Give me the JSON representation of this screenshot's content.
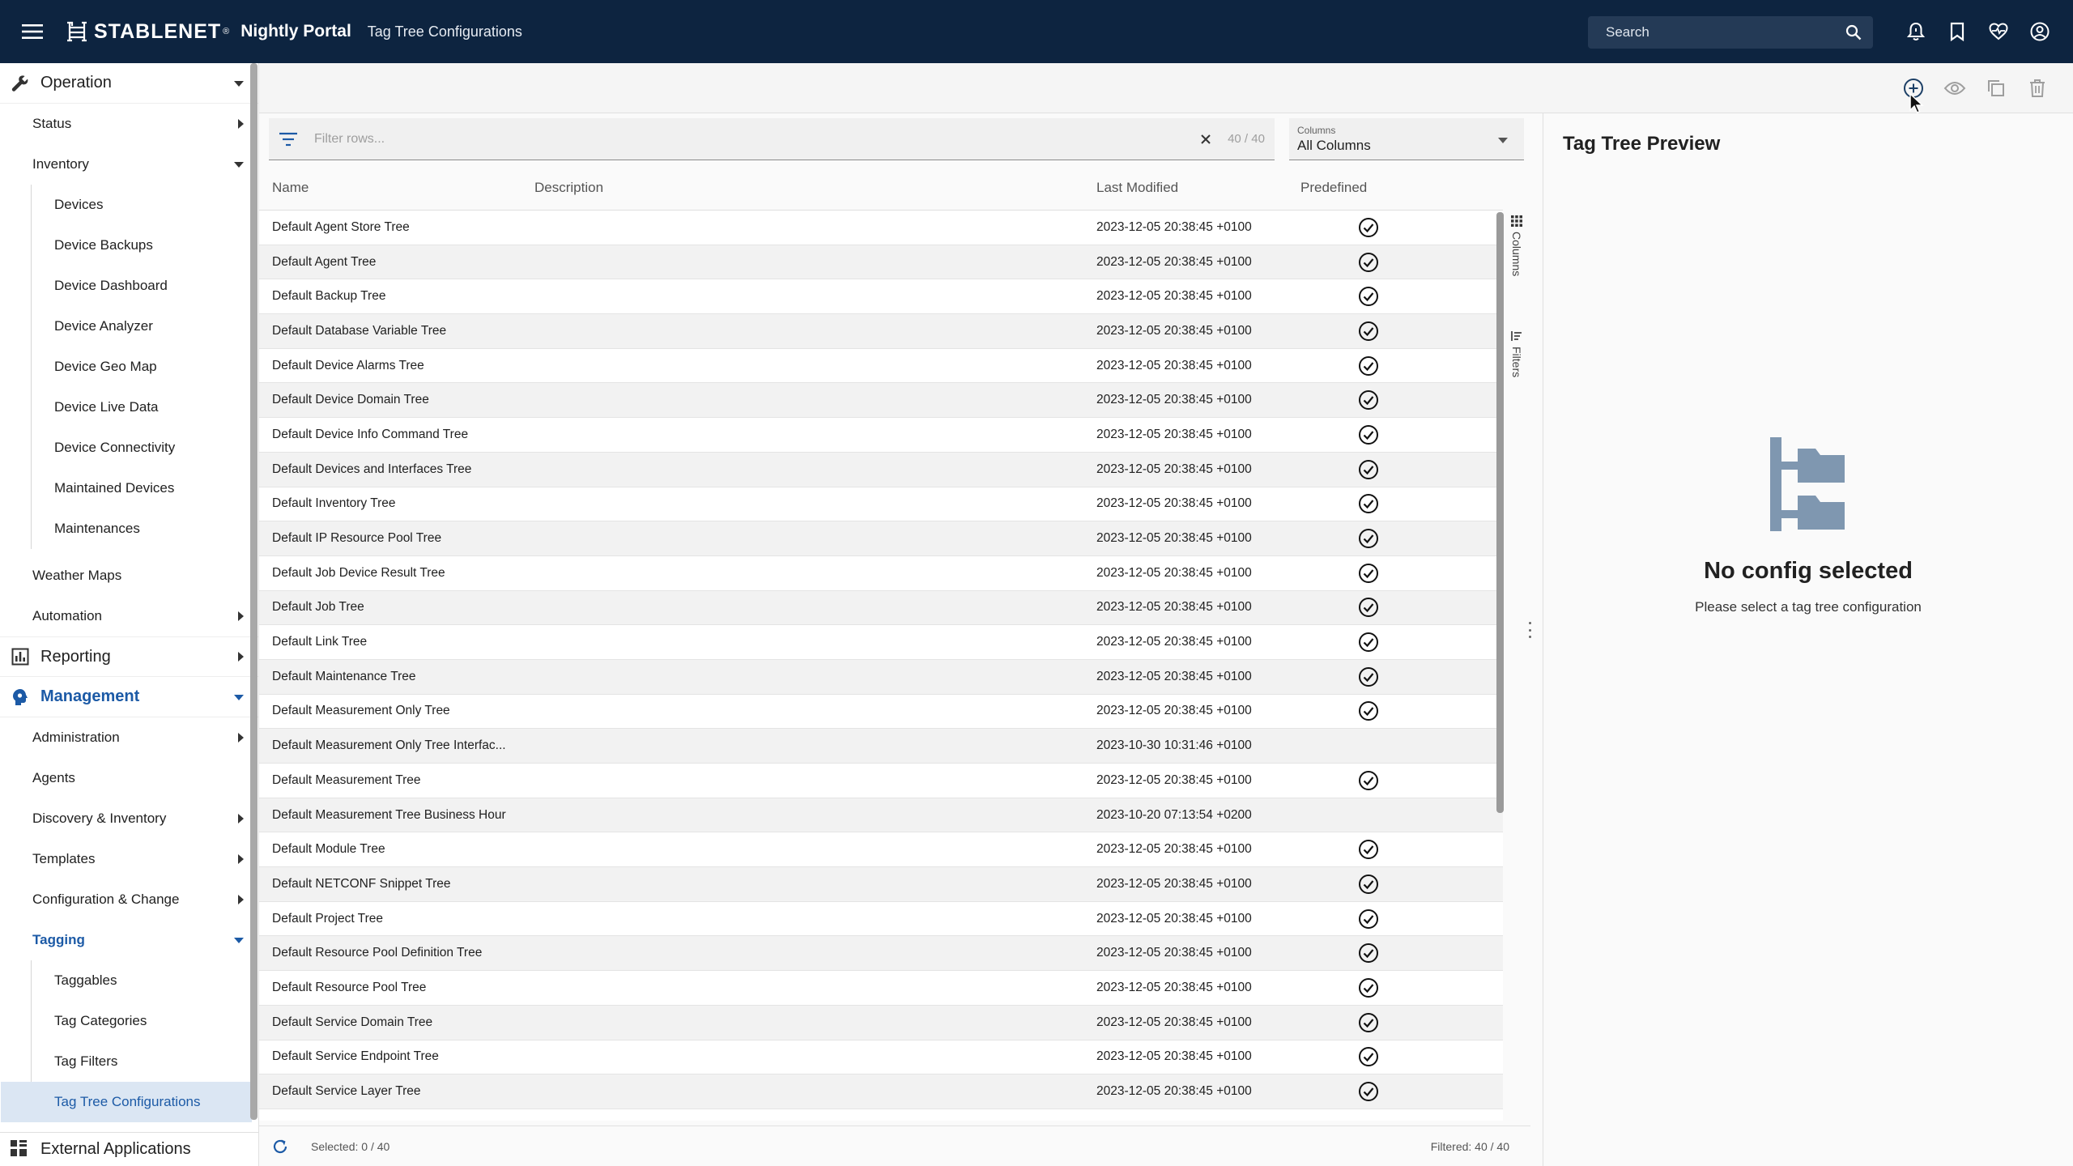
{
  "header": {
    "brand": "STABLENET",
    "brand_sup": "®",
    "portal": "Nightly Portal",
    "page": "Tag Tree Configurations",
    "search_placeholder": "Search"
  },
  "sidebar": {
    "operation": "Operation",
    "status": "Status",
    "inventory": "Inventory",
    "inventory_items": [
      "Devices",
      "Device Backups",
      "Device Dashboard",
      "Device Analyzer",
      "Device Geo Map",
      "Device Live Data",
      "Device Connectivity",
      "Maintained Devices",
      "Maintenances"
    ],
    "weather_maps": "Weather Maps",
    "automation": "Automation",
    "reporting": "Reporting",
    "management": "Management",
    "administration": "Administration",
    "agents": "Agents",
    "discovery": "Discovery & Inventory",
    "templates": "Templates",
    "config_change": "Configuration & Change",
    "tagging": "Tagging",
    "tagging_items": [
      "Taggables",
      "Tag Categories",
      "Tag Filters",
      "Tag Tree Configurations"
    ],
    "external": "External Applications"
  },
  "filter": {
    "placeholder": "Filter rows...",
    "count": "40 / 40",
    "columns_label": "Columns",
    "columns_value": "All Columns"
  },
  "table": {
    "headers": [
      "Name",
      "Description",
      "Last Modified",
      "Predefined"
    ],
    "rows": [
      {
        "name": "Default Agent Store Tree",
        "modified": "2023-12-05 20:38:45 +0100",
        "predefined": true
      },
      {
        "name": "Default Agent Tree",
        "modified": "2023-12-05 20:38:45 +0100",
        "predefined": true
      },
      {
        "name": "Default Backup Tree",
        "modified": "2023-12-05 20:38:45 +0100",
        "predefined": true
      },
      {
        "name": "Default Database Variable Tree",
        "modified": "2023-12-05 20:38:45 +0100",
        "predefined": true
      },
      {
        "name": "Default Device Alarms Tree",
        "modified": "2023-12-05 20:38:45 +0100",
        "predefined": true
      },
      {
        "name": "Default Device Domain Tree",
        "modified": "2023-12-05 20:38:45 +0100",
        "predefined": true
      },
      {
        "name": "Default Device Info Command Tree",
        "modified": "2023-12-05 20:38:45 +0100",
        "predefined": true
      },
      {
        "name": "Default Devices and Interfaces Tree",
        "modified": "2023-12-05 20:38:45 +0100",
        "predefined": true
      },
      {
        "name": "Default Inventory Tree",
        "modified": "2023-12-05 20:38:45 +0100",
        "predefined": true
      },
      {
        "name": "Default IP Resource Pool Tree",
        "modified": "2023-12-05 20:38:45 +0100",
        "predefined": true
      },
      {
        "name": "Default Job Device Result Tree",
        "modified": "2023-12-05 20:38:45 +0100",
        "predefined": true
      },
      {
        "name": "Default Job Tree",
        "modified": "2023-12-05 20:38:45 +0100",
        "predefined": true
      },
      {
        "name": "Default Link Tree",
        "modified": "2023-12-05 20:38:45 +0100",
        "predefined": true
      },
      {
        "name": "Default Maintenance Tree",
        "modified": "2023-12-05 20:38:45 +0100",
        "predefined": true
      },
      {
        "name": "Default Measurement Only Tree",
        "modified": "2023-12-05 20:38:45 +0100",
        "predefined": true
      },
      {
        "name": "Default Measurement Only Tree Interfac...",
        "modified": "2023-10-30 10:31:46 +0100",
        "predefined": false
      },
      {
        "name": "Default Measurement Tree",
        "modified": "2023-12-05 20:38:45 +0100",
        "predefined": true
      },
      {
        "name": "Default Measurement Tree Business Hour",
        "modified": "2023-10-20 07:13:54 +0200",
        "predefined": false
      },
      {
        "name": "Default Module Tree",
        "modified": "2023-12-05 20:38:45 +0100",
        "predefined": true
      },
      {
        "name": "Default NETCONF Snippet Tree",
        "modified": "2023-12-05 20:38:45 +0100",
        "predefined": true
      },
      {
        "name": "Default Project Tree",
        "modified": "2023-12-05 20:38:45 +0100",
        "predefined": true
      },
      {
        "name": "Default Resource Pool Definition Tree",
        "modified": "2023-12-05 20:38:45 +0100",
        "predefined": true
      },
      {
        "name": "Default Resource Pool Tree",
        "modified": "2023-12-05 20:38:45 +0100",
        "predefined": true
      },
      {
        "name": "Default Service Domain Tree",
        "modified": "2023-12-05 20:38:45 +0100",
        "predefined": true
      },
      {
        "name": "Default Service Endpoint Tree",
        "modified": "2023-12-05 20:38:45 +0100",
        "predefined": true
      },
      {
        "name": "Default Service Layer Tree",
        "modified": "2023-12-05 20:38:45 +0100",
        "predefined": true
      }
    ]
  },
  "side_tabs": {
    "columns": "Columns",
    "filters": "Filters"
  },
  "footer": {
    "selected": "Selected: 0 / 40",
    "filtered": "Filtered: 40 / 40"
  },
  "preview": {
    "title": "Tag Tree Preview",
    "empty_title": "No config selected",
    "empty_text": "Please select a tag tree configuration"
  },
  "colors": {
    "header_bg": "#0d2440",
    "accent": "#1c5aa6",
    "tree_icon": "#7f97b0"
  }
}
